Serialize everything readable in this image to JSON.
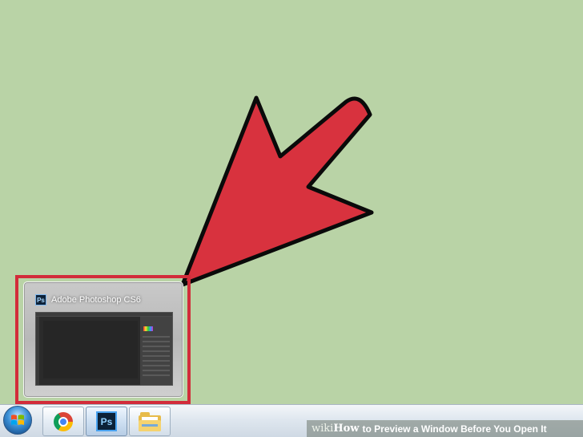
{
  "desktop": {
    "background_color": "#b9d3a6"
  },
  "arrow": {
    "color": "#d8323e",
    "outline": "#0a0a0a",
    "icon": "arrow-pointing-down-left"
  },
  "thumbnail": {
    "title": "Adobe Photoshop CS6",
    "app_icon_text": "Ps",
    "highlight_color": "#d22c3a"
  },
  "taskbar": {
    "start_button_icon": "windows-logo-icon",
    "buttons": [
      {
        "name": "chrome",
        "icon": "chrome-icon"
      },
      {
        "name": "photoshop",
        "icon": "photoshop-icon",
        "label": "Ps",
        "active": true
      },
      {
        "name": "explorer",
        "icon": "folder-icon"
      }
    ]
  },
  "watermark": {
    "prefix": "wiki",
    "how": "How",
    "text": " to Preview a Window Before You Open It"
  }
}
